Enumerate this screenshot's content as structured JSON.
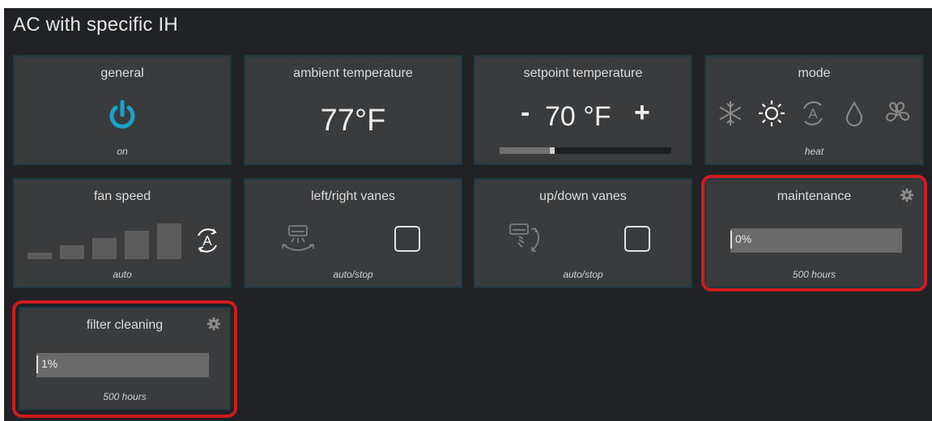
{
  "app": {
    "title": "AC with specific IH"
  },
  "general": {
    "title": "general",
    "status": "on"
  },
  "ambient": {
    "title": "ambient temperature",
    "value": "77°F"
  },
  "setpoint": {
    "title": "setpoint temperature",
    "minus": "-",
    "value": "70 °F",
    "plus": "+",
    "slider_level": 0.32
  },
  "mode": {
    "title": "mode",
    "icons": [
      "snowflake-icon",
      "sun-icon",
      "auto-icon",
      "drop-icon",
      "fan-icon"
    ],
    "selected": "sun-icon",
    "status": "heat"
  },
  "fan_speed": {
    "title": "fan speed",
    "levels": 5,
    "auto_label": "A",
    "status": "auto"
  },
  "lr_vanes": {
    "title": "left/right vanes",
    "status": "auto/stop"
  },
  "ud_vanes": {
    "title": "up/down vanes",
    "status": "auto/stop"
  },
  "maintenance": {
    "title": "maintenance",
    "value": "0%",
    "status": "500 hours"
  },
  "filter": {
    "title": "filter cleaning",
    "value": "1%",
    "status": "500 hours"
  },
  "colors": {
    "background": "#202225",
    "tile": "#3a3b3d",
    "accent": "#1aa3c9",
    "highlight": "#cf1b1b"
  }
}
